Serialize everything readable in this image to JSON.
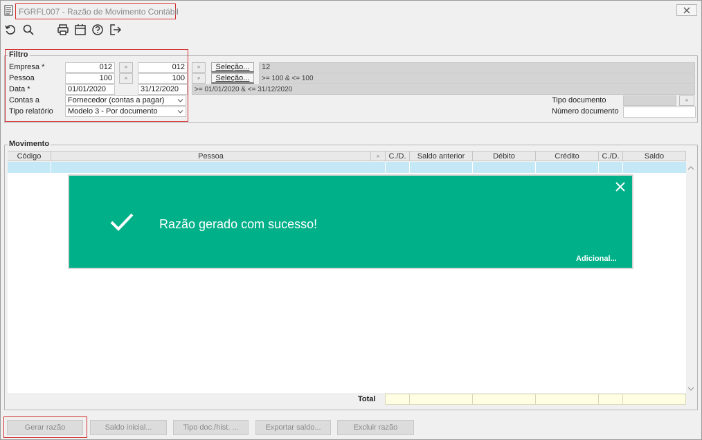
{
  "window": {
    "title": "FGRFL007 - Razão de Movimento Contábil",
    "close_icon": "close-icon"
  },
  "toolbar": {
    "icons": [
      "refresh-icon",
      "search-icon",
      "print-icon",
      "calendar-icon",
      "help-icon",
      "exit-icon"
    ]
  },
  "filtro": {
    "legend": "Filtro",
    "empresa_label": "Empresa *",
    "empresa_from": "012",
    "empresa_to": "012",
    "empresa_summary": "12",
    "pessoa_label": "Pessoa",
    "pessoa_from": "100",
    "pessoa_to": "100",
    "pessoa_summary": ">= 100  &  <= 100",
    "data_label": "Data *",
    "data_from": "01/01/2020",
    "data_to": "31/12/2020",
    "data_summary": ">= 01/01/2020  &  <= 31/12/2020",
    "contas_label": "Contas a",
    "contas_value": "Fornecedor (contas a pagar)",
    "tipo_relatorio_label": "Tipo relatório",
    "tipo_relatorio_value": "Modelo 3 - Por documento",
    "tipo_documento_label": "Tipo documento",
    "numero_documento_label": "Número documento",
    "selecao_label": "Seleção..."
  },
  "movimento": {
    "legend": "Movimento",
    "columns": [
      "Código",
      "Pessoa",
      "C./D.",
      "Saldo anterior",
      "Débito",
      "Crédito",
      "C./D.",
      "Saldo"
    ],
    "total_label": "Total"
  },
  "buttons": {
    "gerar": "Gerar razão",
    "saldo_inicial": "Saldo inicial...",
    "tipo_doc": "Tipo doc./hist. ...",
    "exportar": "Exportar saldo...",
    "excluir": "Excluir razão"
  },
  "toast": {
    "message": "Razão gerado com sucesso!",
    "more": "Adicional...",
    "color": "#00b089"
  }
}
